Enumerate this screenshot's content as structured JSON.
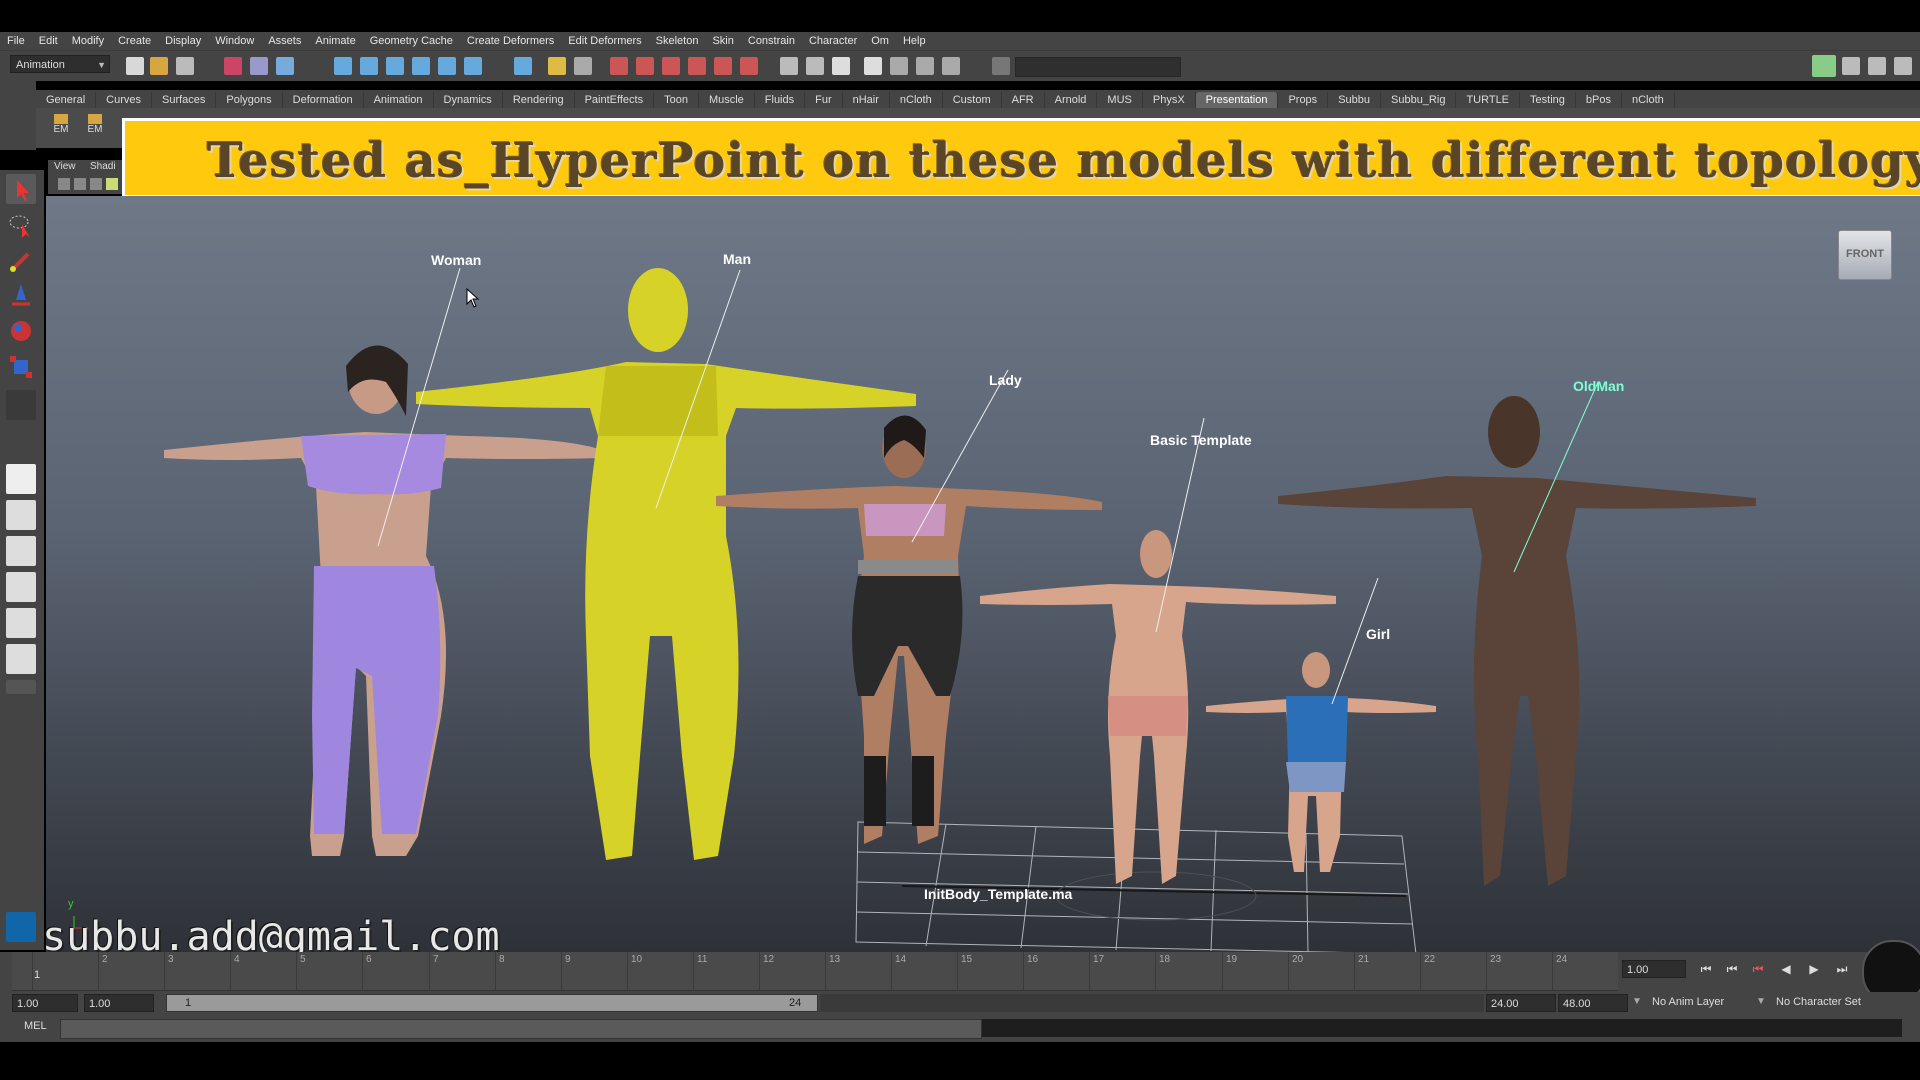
{
  "menubar": [
    "File",
    "Edit",
    "Modify",
    "Create",
    "Display",
    "Window",
    "Assets",
    "Animate",
    "Geometry Cache",
    "Create Deformers",
    "Edit Deformers",
    "Skeleton",
    "Skin",
    "Constrain",
    "Character",
    "Om",
    "Help"
  ],
  "statusline": {
    "mode": "Animation"
  },
  "shelf": {
    "tabs": [
      "General",
      "Curves",
      "Surfaces",
      "Polygons",
      "Deformation",
      "Animation",
      "Dynamics",
      "Rendering",
      "PaintEffects",
      "Toon",
      "Muscle",
      "Fluids",
      "Fur",
      "nHair",
      "nCloth",
      "Custom",
      "AFR",
      "Arnold",
      "MUS",
      "PhysX",
      "Presentation",
      "Props",
      "Subbu",
      "Subbu_Rig",
      "TURTLE",
      "Testing",
      "bPos",
      "nCloth"
    ],
    "active_tab": "Presentation",
    "buttons": [
      "EM",
      "EM"
    ]
  },
  "banner": {
    "text": "Tested as_HyperPoint on these models with different topology"
  },
  "panel_menu": [
    "View",
    "Shadi"
  ],
  "viewport": {
    "view_cube": "FRONT",
    "models": [
      {
        "name": "Woman",
        "color": "#ffffff"
      },
      {
        "name": "Man",
        "color": "#ffffff"
      },
      {
        "name": "Lady",
        "color": "#ffffff"
      },
      {
        "name": "Basic Template",
        "color": "#ffffff"
      },
      {
        "name": "Girl",
        "color": "#ffffff"
      },
      {
        "name": "OldMan",
        "color": "#7fffd4"
      }
    ],
    "file_label": "InitBody_Template.ma",
    "axis_y": "y"
  },
  "watermark": {
    "email": "subbu.add@gmail.com"
  },
  "timeslider": {
    "ticks": [
      "1",
      "2",
      "3",
      "4",
      "5",
      "6",
      "7",
      "8",
      "9",
      "10",
      "11",
      "12",
      "13",
      "14",
      "15",
      "16",
      "17",
      "18",
      "19",
      "20",
      "21",
      "22",
      "23",
      "24"
    ],
    "current_frame": "1.00"
  },
  "rangeslider": {
    "start_time": "1.00",
    "start_range": "1.00",
    "range_start_label": "1",
    "range_end_label": "24",
    "end_range": "24.00",
    "end_time": "48.00",
    "anim_layer": "No Anim Layer",
    "character_set": "No Character Set"
  },
  "cmdline": {
    "label": "MEL"
  },
  "colors": {
    "banner": "#ffc90d",
    "ui_bg": "#444444",
    "active_tab": "#666666"
  }
}
